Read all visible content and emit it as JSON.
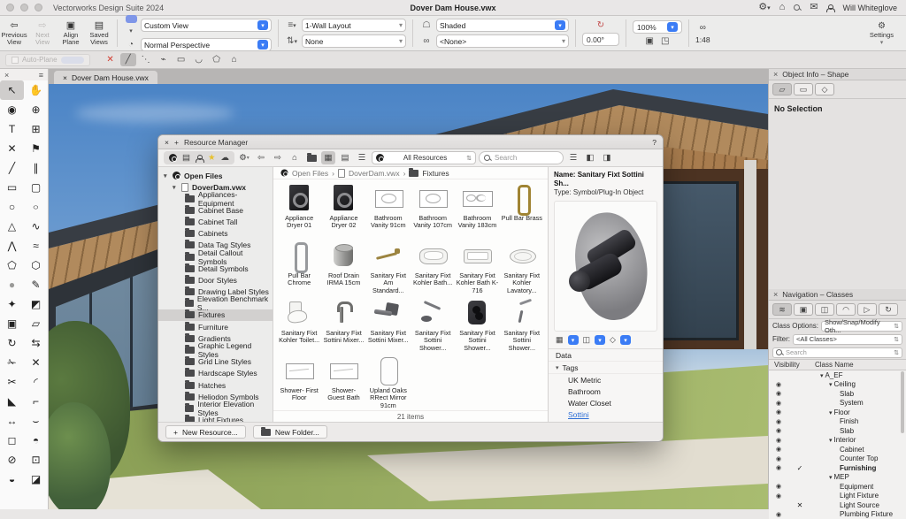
{
  "colors": {
    "accent": "#3b7cf5",
    "sky_top": "#4b84c6",
    "grass_green": "#92a75d",
    "roof_wood": "#b18a5d",
    "star_yellow": "#e7c12f"
  },
  "icons": {
    "gear": "⚙",
    "home": "⌂",
    "mail": "✉",
    "chev": "▾",
    "back": "⇦",
    "fwd": "⇨",
    "star": "★",
    "cloud": "☁",
    "printer": "▤",
    "grid": "▦",
    "list": "▤",
    "detail": "☰",
    "stack": "☰",
    "panel_left": "◧",
    "panel_right": "◨",
    "close": "×",
    "plus": "+",
    "help": "?",
    "rotate": "↻",
    "link": "∞",
    "fit1": "▣",
    "fit2": "◳",
    "updown": "⇅",
    "crumb_sep": "›",
    "oi_tab1": "▱",
    "oi_tab2": "▭",
    "oi_tab3": "◇",
    "nav1": "≋",
    "nav2": "▣",
    "nav3": "◫",
    "nav4": "◠",
    "nav5": "▷",
    "nav6": "↻",
    "eye": "◉",
    "saved_views": "▤",
    "prev": "⇦",
    "next": "⇨",
    "align": "▣",
    "view_persp": "◔",
    "layers": "≡",
    "move": "⇅",
    "shaded": "☖",
    "glasses": "∞"
  },
  "menubar": {
    "app_title": "Vectorworks Design Suite 2024",
    "doc_title": "Dover Dam House.vwx",
    "user": "Will Whiteglove"
  },
  "toolbar": {
    "nav": [
      {
        "label": "Previous View",
        "g": "⇦",
        "state": ""
      },
      {
        "label": "Next View",
        "g": "⇨",
        "state": "dis"
      },
      {
        "label": "Align Plane",
        "g": "▣",
        "state": "pink"
      },
      {
        "label": "Saved Views",
        "g": "▤",
        "state": ""
      }
    ],
    "view_row1": "Custom View",
    "view_row2": "Normal Perspective",
    "layout_row1": "1-Wall Layout",
    "layout_row2": "None",
    "render_row1": "Shaded",
    "render_row2": "<None>",
    "rotation": "0.00°",
    "zoom": "100%",
    "scale": "1:48",
    "settings": "Settings"
  },
  "modebar": {
    "auto_plane": "Auto-Plane",
    "icons": [
      {
        "g": "✕",
        "cls": "red"
      },
      {
        "g": "╱",
        "cls": "sel"
      },
      {
        "g": "⋱",
        "cls": ""
      },
      {
        "g": "⌁",
        "cls": ""
      },
      {
        "g": "▭",
        "cls": ""
      },
      {
        "g": "◡",
        "cls": ""
      },
      {
        "g": "⬠",
        "cls": ""
      },
      {
        "g": "⌂",
        "cls": ""
      }
    ]
  },
  "tabbar": {
    "close": "×",
    "title": "Dover Dam House.vwx"
  },
  "tool_palette": {
    "close": "×",
    "menu": "≡",
    "tools": [
      {
        "g": "↖",
        "n": "selection-tool",
        "cls": "selected"
      },
      {
        "g": "✋",
        "n": "pan-tool"
      },
      {
        "g": "◉",
        "n": "flyover-tool"
      },
      {
        "g": "⊕",
        "n": "zoom-tool"
      },
      {
        "g": "T",
        "n": "text-tool"
      },
      {
        "g": "⊞",
        "n": "callout-tool"
      },
      {
        "g": "✕",
        "n": "stake-tool"
      },
      {
        "g": "⚑",
        "n": "plant-tool"
      },
      {
        "g": "╱",
        "n": "line-tool"
      },
      {
        "g": "∥",
        "n": "double-line-tool"
      },
      {
        "g": "▭",
        "n": "rectangle-tool"
      },
      {
        "g": "▢",
        "n": "rounded-rectangle-tool"
      },
      {
        "g": "○",
        "n": "circle-tool"
      },
      {
        "g": "○",
        "n": "ellipse-tool",
        "cls": "squish"
      },
      {
        "g": "△",
        "n": "arc-tool"
      },
      {
        "g": "∿",
        "n": "freehand-tool"
      },
      {
        "g": "⋀",
        "n": "polyline-tool"
      },
      {
        "g": "≈",
        "n": "spline-tool"
      },
      {
        "g": "⬠",
        "n": "polygon-tool"
      },
      {
        "g": "⬡",
        "n": "regular-polygon-tool"
      },
      {
        "g": "●",
        "n": "fill-tool",
        "cls": "graydot"
      },
      {
        "g": "✎",
        "n": "eyedropper-tool"
      },
      {
        "g": "✦",
        "n": "wand-tool"
      },
      {
        "g": "◩",
        "n": "select-similar-tool"
      },
      {
        "g": "▣",
        "n": "clip-tool"
      },
      {
        "g": "▱",
        "n": "reshape-tool"
      },
      {
        "g": "↻",
        "n": "rotate-tool"
      },
      {
        "g": "⇆",
        "n": "mirror-tool"
      },
      {
        "g": "✁",
        "n": "knife-tool"
      },
      {
        "g": "✕",
        "n": "trim-tool"
      },
      {
        "g": "✂",
        "n": "split-tool"
      },
      {
        "g": "◜",
        "n": "fillet-tool"
      },
      {
        "g": "◣",
        "n": "chamfer-tool"
      },
      {
        "g": "⌐",
        "n": "offset-tool"
      },
      {
        "g": "↔",
        "n": "resize-tool"
      },
      {
        "g": "⌣",
        "n": "tangent-tool"
      },
      {
        "g": "◻",
        "n": "surface-tool"
      },
      {
        "g": "◓",
        "n": "dome-tool"
      },
      {
        "g": "⊘",
        "n": "clip-cube-tool"
      },
      {
        "g": "⊡",
        "n": "stamp-tool"
      },
      {
        "g": "◒",
        "n": "protractor-tool"
      },
      {
        "g": "◪",
        "n": "texture-tool"
      }
    ]
  },
  "resource_manager": {
    "title": "Resource Manager",
    "filter_value": "All Resources",
    "search_placeholder": "Search",
    "breadcrumb": [
      "Open Files",
      "DoverDam.vwx",
      "Fixtures"
    ],
    "tree_root": "Open Files",
    "tree_file": "DoverDam.vwx",
    "folders": [
      {
        "label": "Appliances-Equipment"
      },
      {
        "label": "Cabinet Base"
      },
      {
        "label": "Cabinet Tall"
      },
      {
        "label": "Cabinets"
      },
      {
        "label": "Data Tag Styles"
      },
      {
        "label": "Detail Callout Symbols"
      },
      {
        "label": "Detail Symbols"
      },
      {
        "label": "Door Styles"
      },
      {
        "label": "Drawing Label Styles"
      },
      {
        "label": "Elevation Benchmark S..."
      },
      {
        "label": "Fixtures",
        "state": "sel"
      },
      {
        "label": "Furniture"
      },
      {
        "label": "Gradients"
      },
      {
        "label": "Graphic Legend Styles"
      },
      {
        "label": "Grid Line Styles"
      },
      {
        "label": "Hardscape Styles"
      },
      {
        "label": "Hatches"
      },
      {
        "label": "Heliodon Symbols"
      },
      {
        "label": "Interior Elevation Styles"
      },
      {
        "label": "Light Fixtures"
      }
    ],
    "items": [
      {
        "label": "Appliance Dryer 01",
        "thumb": "dryer"
      },
      {
        "label": "Appliance Dryer 02",
        "thumb": "dryer"
      },
      {
        "label": "Bathroom Vanity 91cm",
        "thumb": "vanity"
      },
      {
        "label": "Bathroom Vanity 107cm",
        "thumb": "vanity"
      },
      {
        "label": "Bathroom Vanity 183cm",
        "thumb": "vanity2"
      },
      {
        "label": "Pull Bar Brass",
        "thumb": "loopb"
      },
      {
        "label": "Pull Bar Chrome",
        "thumb": "loopc"
      },
      {
        "label": "Roof Drain IRMA 15cm",
        "thumb": "drain"
      },
      {
        "label": "Sanitary Fixt Am Standard...",
        "thumb": "faucetb"
      },
      {
        "label": "Sanitary Fixt Kohler Bath...",
        "thumb": "tub"
      },
      {
        "label": "Sanitary Fixt Kohler Bath K-716",
        "thumb": "tubr"
      },
      {
        "label": "Sanitary Fixt Kohler Lavatory...",
        "thumb": "sink"
      },
      {
        "label": "Sanitary Fixt Kohler Toilet...",
        "thumb": "toilet"
      },
      {
        "label": "Sanitary Fixt Sottini Mixer...",
        "thumb": "tap"
      },
      {
        "label": "Sanitary Fixt Sottini Mixer...",
        "thumb": "spout"
      },
      {
        "label": "Sanitary Fixt Sottini Shower...",
        "thumb": "wand"
      },
      {
        "label": "Sanitary Fixt Sottini Shower...",
        "thumb": "darkpanel"
      },
      {
        "label": "Sanitary Fixt Sottini Shower...",
        "thumb": "arm"
      },
      {
        "label": "Shower- First Floor",
        "thumb": "plan"
      },
      {
        "label": "Shower- Guest Bath",
        "thumb": "plan"
      },
      {
        "label": "Upland Oaks RRect Mirror 91cm",
        "thumb": "mirror"
      }
    ],
    "status": "21 items",
    "detail": {
      "name_label": "Name:",
      "name_value": "Sanitary Fixt Sottini Sh...",
      "type_label": "Type:",
      "type_value": "Symbol/Plug-In Object",
      "sections": {
        "data": "Data",
        "tags": "Tags"
      },
      "tags": [
        {
          "label": "UK Metric"
        },
        {
          "label": "Bathroom"
        },
        {
          "label": "Water Closet"
        },
        {
          "label": "Sottini",
          "state": "link"
        }
      ]
    },
    "buttons": {
      "new_resource": "New Resource...",
      "new_folder": "New Folder..."
    }
  },
  "object_info": {
    "title": "Object Info – Shape",
    "no_selection": "No Selection"
  },
  "navigation": {
    "title": "Navigation – Classes",
    "class_options_label": "Class Options:",
    "class_options_value": "Show/Snap/Modify Oth...",
    "filter_label": "Filter:",
    "filter_value": "<All Classes>",
    "search_placeholder": "Search",
    "col_visibility": "Visibility",
    "col_class_name": "Class Name",
    "classes": [
      {
        "name": "A_EF",
        "ind": "i0",
        "exp": "exp",
        "eye": "noeye",
        "mark": "",
        "bold": ""
      },
      {
        "name": "Ceiling",
        "ind": "i1",
        "exp": "exp",
        "eye": "eye",
        "mark": "",
        "bold": ""
      },
      {
        "name": "Slab",
        "ind": "i2",
        "exp": "",
        "eye": "eye",
        "mark": "",
        "bold": ""
      },
      {
        "name": "System",
        "ind": "i2",
        "exp": "",
        "eye": "eye",
        "mark": "",
        "bold": ""
      },
      {
        "name": "Floor",
        "ind": "i1",
        "exp": "exp",
        "eye": "eye",
        "mark": "",
        "bold": ""
      },
      {
        "name": "Finish",
        "ind": "i2",
        "exp": "",
        "eye": "eye",
        "mark": "",
        "bold": ""
      },
      {
        "name": "Slab",
        "ind": "i2",
        "exp": "",
        "eye": "eye",
        "mark": "",
        "bold": ""
      },
      {
        "name": "Interior",
        "ind": "i1",
        "exp": "exp",
        "eye": "eye",
        "mark": "",
        "bold": ""
      },
      {
        "name": "Cabinet",
        "ind": "i2",
        "exp": "",
        "eye": "eye",
        "mark": "",
        "bold": ""
      },
      {
        "name": "Counter Top",
        "ind": "i2",
        "exp": "",
        "eye": "eye",
        "mark": "",
        "bold": ""
      },
      {
        "name": "Furnishing",
        "ind": "i2",
        "exp": "",
        "eye": "eye",
        "mark": "check",
        "bold": "bold"
      },
      {
        "name": "MEP",
        "ind": "i1",
        "exp": "exp",
        "eye": "noeye",
        "mark": "",
        "bold": ""
      },
      {
        "name": "Equipment",
        "ind": "i2",
        "exp": "",
        "eye": "eye",
        "mark": "",
        "bold": ""
      },
      {
        "name": "Light Fixture",
        "ind": "i2",
        "exp": "",
        "eye": "eye",
        "mark": "",
        "bold": ""
      },
      {
        "name": "Light Source",
        "ind": "i2",
        "exp": "",
        "eye": "noeye",
        "mark": "x",
        "bold": ""
      },
      {
        "name": "Plumbing Fixture",
        "ind": "i2",
        "exp": "",
        "eye": "eye",
        "mark": "",
        "bold": ""
      }
    ]
  }
}
